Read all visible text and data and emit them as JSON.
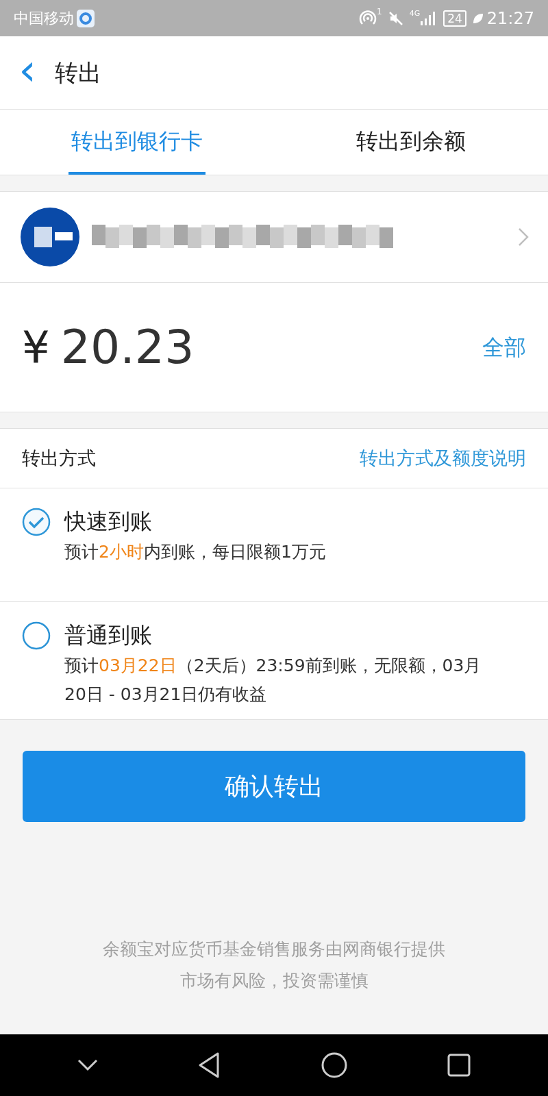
{
  "status_bar": {
    "carrier": "中国移动",
    "hotspot_count": "1",
    "network": "4G",
    "battery": "24",
    "time": "21:27"
  },
  "header": {
    "back": "‹",
    "title": "转出"
  },
  "tabs": [
    {
      "label": "转出到银行卡",
      "selected": true
    },
    {
      "label": "转出到余额",
      "selected": false
    }
  ],
  "amount": {
    "currency": "¥",
    "value": "20.23",
    "all_link": "全部"
  },
  "method": {
    "label": "转出方式",
    "help_link": "转出方式及额度说明"
  },
  "options": [
    {
      "title": "快速到账",
      "selected": true,
      "desc": [
        {
          "text": "预计",
          "highlight": false
        },
        {
          "text": "2小时",
          "highlight": true
        },
        {
          "text": "内到账，每日限额1万元",
          "highlight": false
        }
      ]
    },
    {
      "title": "普通到账",
      "selected": false,
      "desc": [
        {
          "text": "预计",
          "highlight": false
        },
        {
          "text": "03月22日",
          "highlight": true
        },
        {
          "text": "（2天后）23:59前到账，无限额，03月20日 - 03月21日仍有收益",
          "highlight": false
        }
      ]
    }
  ],
  "confirm_button": "确认转出",
  "footer": [
    "余额宝对应货币基金销售服务由网商银行提供",
    "市场有风险，投资需谨慎"
  ]
}
